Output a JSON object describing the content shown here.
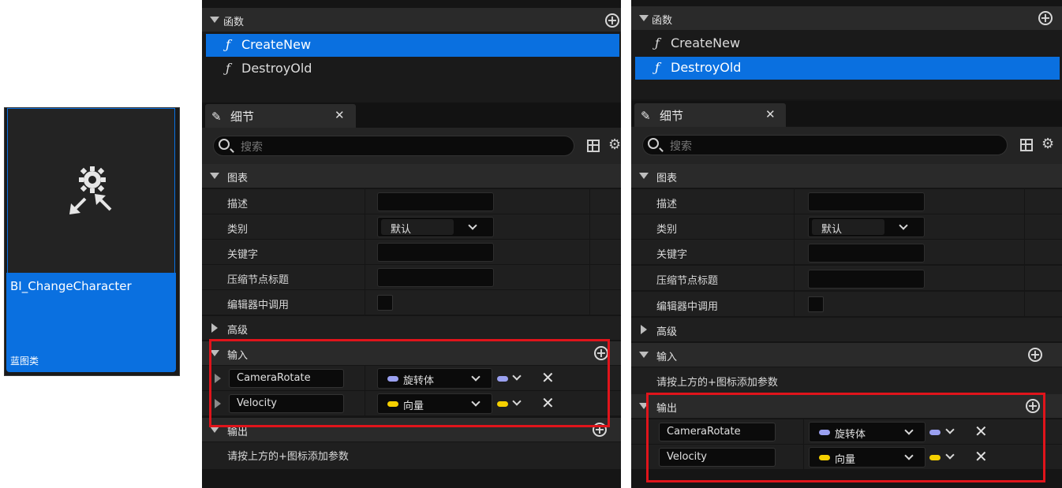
{
  "asset": {
    "name": "BI_ChangeCharacter",
    "type": "蓝图类",
    "icon": "gear-arrows-icon"
  },
  "left": {
    "functions_header": "函数",
    "functions": [
      {
        "name": "CreateNew",
        "selected": true
      },
      {
        "name": "DestroyOld",
        "selected": false
      }
    ],
    "details_tab": "细节",
    "search_placeholder": "搜索",
    "graph_header": "图表",
    "props": {
      "description": "描述",
      "category": "类别",
      "category_value": "默认",
      "keywords": "关键字",
      "compact_title": "压缩节点标题",
      "call_in_editor": "编辑器中调用"
    },
    "advanced_header": "高级",
    "inputs_header": "输入",
    "inputs": [
      {
        "name": "CameraRotate",
        "type": "旋转体",
        "color": "#9aa0f0"
      },
      {
        "name": "Velocity",
        "type": "向量",
        "color": "#f5d000"
      }
    ],
    "outputs_header": "输出",
    "outputs_hint": "请按上方的+图标添加参数"
  },
  "right": {
    "functions_header": "函数",
    "functions": [
      {
        "name": "CreateNew",
        "selected": false
      },
      {
        "name": "DestroyOld",
        "selected": true
      }
    ],
    "details_tab": "细节",
    "search_placeholder": "搜索",
    "graph_header": "图表",
    "props": {
      "description": "描述",
      "category": "类别",
      "category_value": "默认",
      "keywords": "关键字",
      "compact_title": "压缩节点标题",
      "call_in_editor": "编辑器中调用"
    },
    "advanced_header": "高级",
    "inputs_header": "输入",
    "inputs_hint": "请按上方的+图标添加参数",
    "outputs_header": "输出",
    "outputs": [
      {
        "name": "CameraRotate",
        "type": "旋转体",
        "color": "#9aa0f0"
      },
      {
        "name": "Velocity",
        "type": "向量",
        "color": "#f5d000"
      }
    ]
  },
  "colors": {
    "selection": "#0a70e0",
    "highlight_box": "#e0141b",
    "rotator_pin": "#9aa0f0",
    "vector_pin": "#f5d000"
  }
}
